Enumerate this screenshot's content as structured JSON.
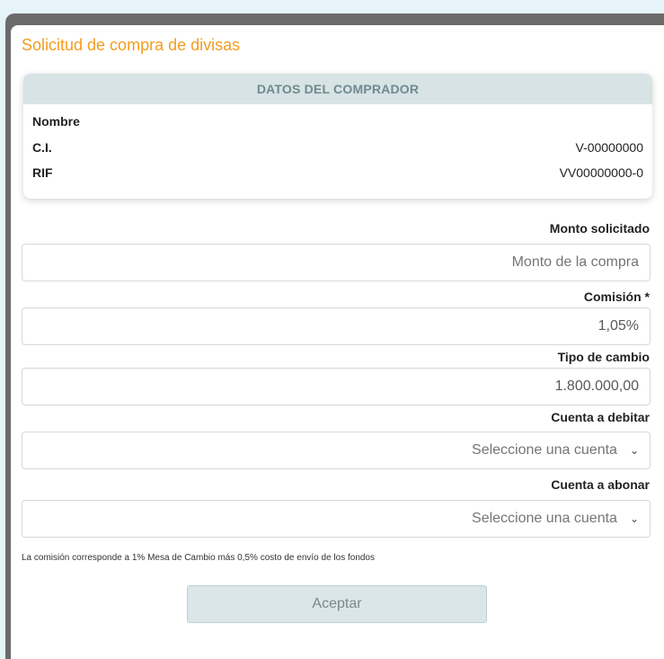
{
  "form": {
    "title": "Solicitud de compra de divisas",
    "buyer_card": {
      "header": "DATOS DEL COMPRADOR",
      "rows": [
        {
          "label": "Nombre",
          "value": ""
        },
        {
          "label": "C.I.",
          "value": "V-00000000"
        },
        {
          "label": "RIF",
          "value": "VV00000000-0"
        }
      ]
    },
    "fields": {
      "monto": {
        "label": "Monto solicitado",
        "placeholder": "Monto de la compra"
      },
      "comision": {
        "label": "Comisión *",
        "value": "1,05%"
      },
      "tipo_cambio": {
        "label": "Tipo de cambio",
        "value": "1.800.000,00"
      },
      "cuenta_debitar": {
        "label": "Cuenta a debitar",
        "selected": "Seleccione una cuenta"
      },
      "cuenta_abonar": {
        "label": "Cuenta a abonar",
        "selected": "Seleccione una cuenta"
      }
    },
    "note": "La comisión corresponde a 1% Mesa de Cambio más 0,5% costo de envío de los fondos",
    "submit_label": "Aceptar"
  },
  "icons": {
    "select_arrow": "chevron-down-icon"
  },
  "colors": {
    "title": "#f39c20",
    "card_header_bg": "#d7e3e5",
    "button_bg": "#dae6e8",
    "page_bg": "#e6f3f8"
  }
}
